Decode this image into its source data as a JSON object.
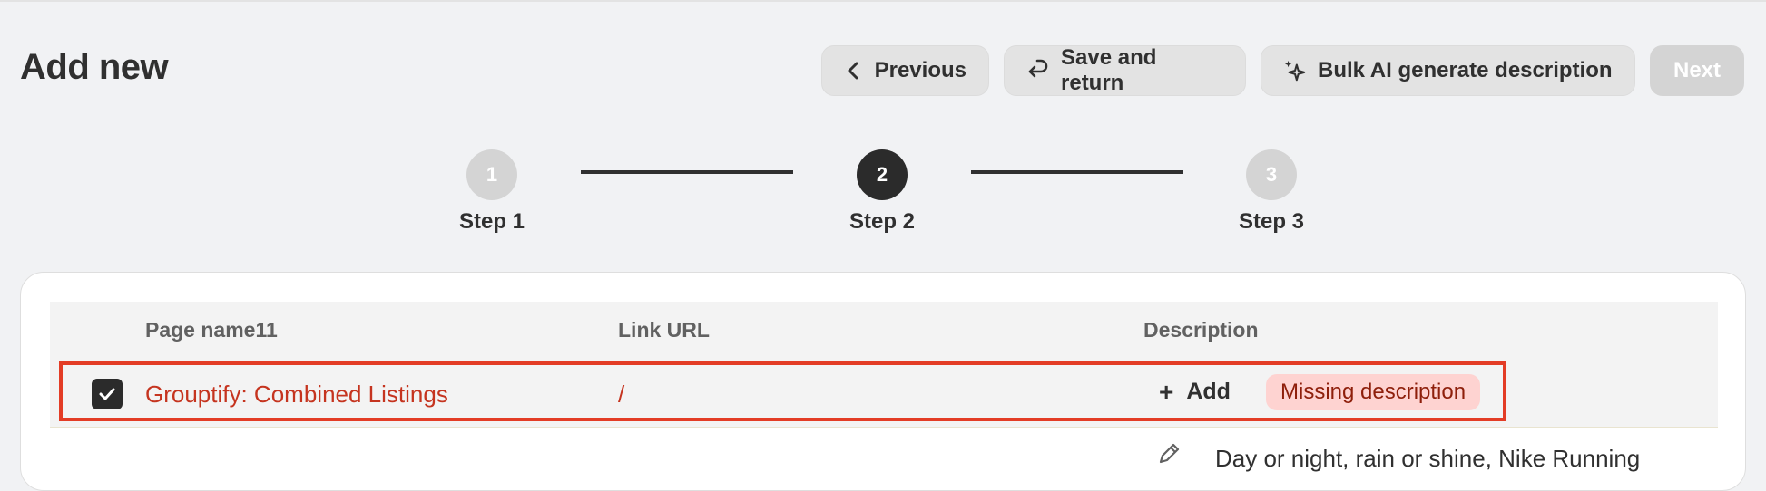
{
  "header": {
    "title": "Add new",
    "buttons": {
      "previous": "Previous",
      "save_return": "Save and return",
      "bulk_ai": "Bulk AI generate description",
      "next": "Next"
    }
  },
  "stepper": {
    "steps": [
      {
        "number": "1",
        "label": "Step 1",
        "state": "inactive"
      },
      {
        "number": "2",
        "label": "Step 2",
        "state": "active"
      },
      {
        "number": "3",
        "label": "Step 3",
        "state": "inactive"
      }
    ]
  },
  "table": {
    "columns": [
      "Page name11",
      "Link URL",
      "Description"
    ],
    "rows": [
      {
        "checked": true,
        "page_name": "Grouptify: Combined Listings",
        "link_url": "/",
        "add_label": "Add",
        "badge": "Missing description"
      }
    ],
    "next_row_description": "Day or night, rain or shine, Nike Running"
  },
  "colors": {
    "background": "#f1f2f4",
    "active_step": "#2b2b2b",
    "highlight_border": "#e33c25",
    "error_text": "#c5341f",
    "badge_bg": "#fed3d1"
  }
}
